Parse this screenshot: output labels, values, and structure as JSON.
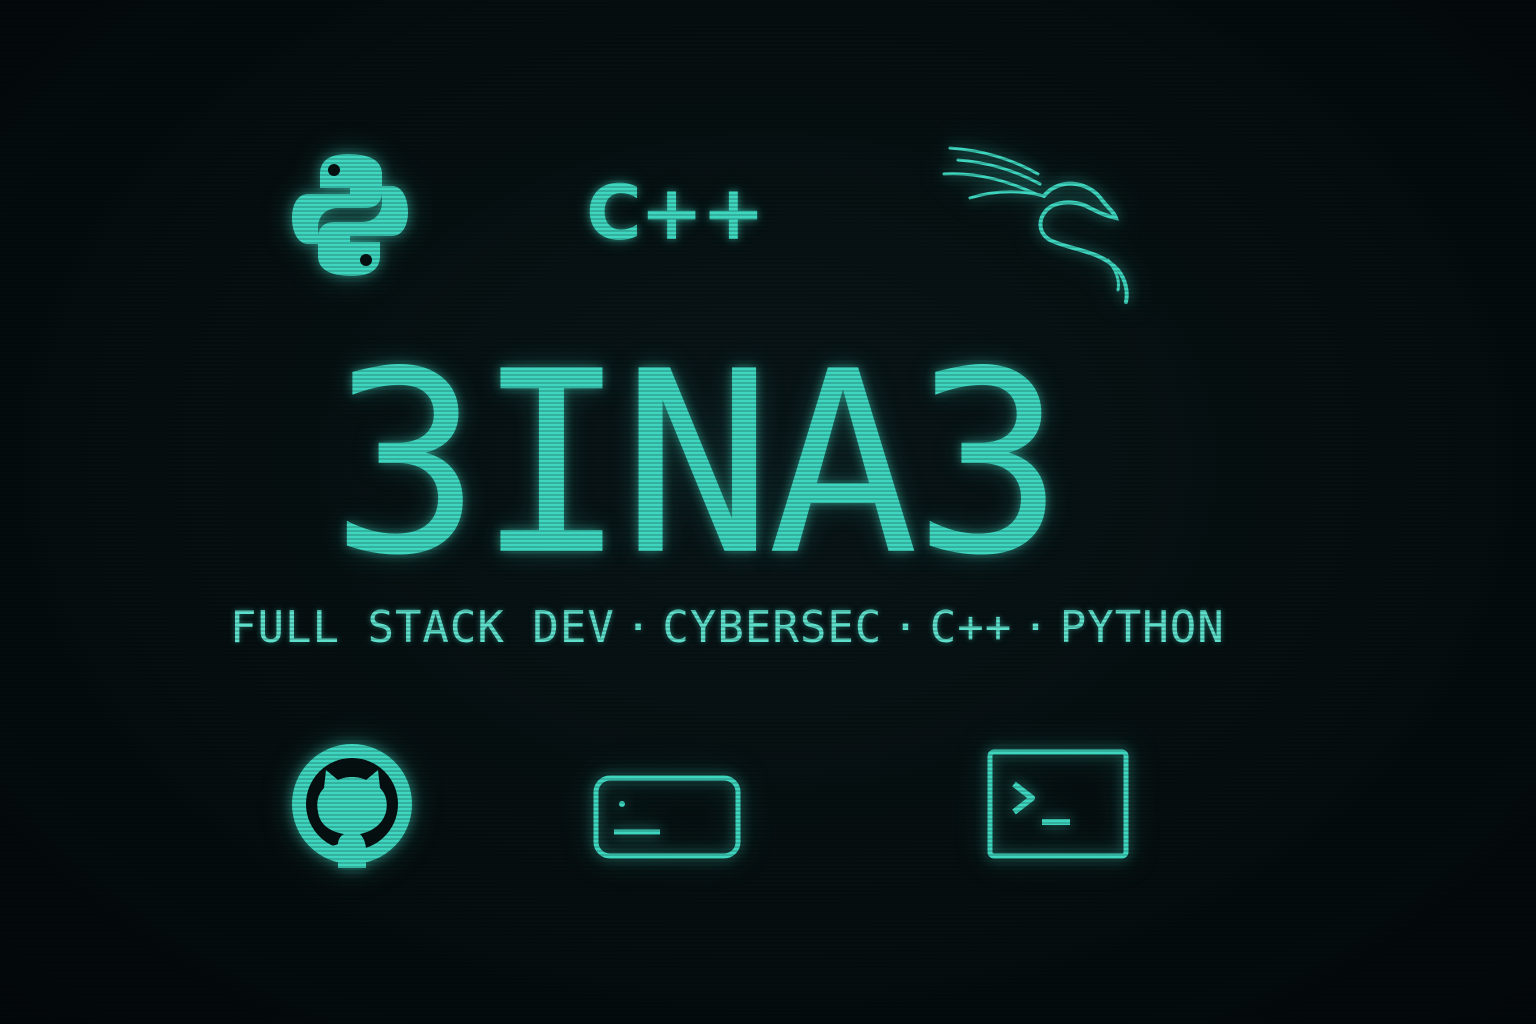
{
  "title": "3INA3",
  "subtitle": {
    "items": [
      "FULL STACK DEV",
      "CYBERSEC",
      "C++",
      "PYTHON"
    ],
    "separator": "·"
  },
  "cpp_logo": "C++",
  "icons": {
    "top_row": [
      "python-icon",
      "cpp-logo",
      "kali-dragon-icon"
    ],
    "bottom_row": [
      "github-icon",
      "input-field-icon",
      "terminal-icon"
    ]
  },
  "colors": {
    "accent": "#3fd6bf",
    "background": "#050a0c"
  }
}
